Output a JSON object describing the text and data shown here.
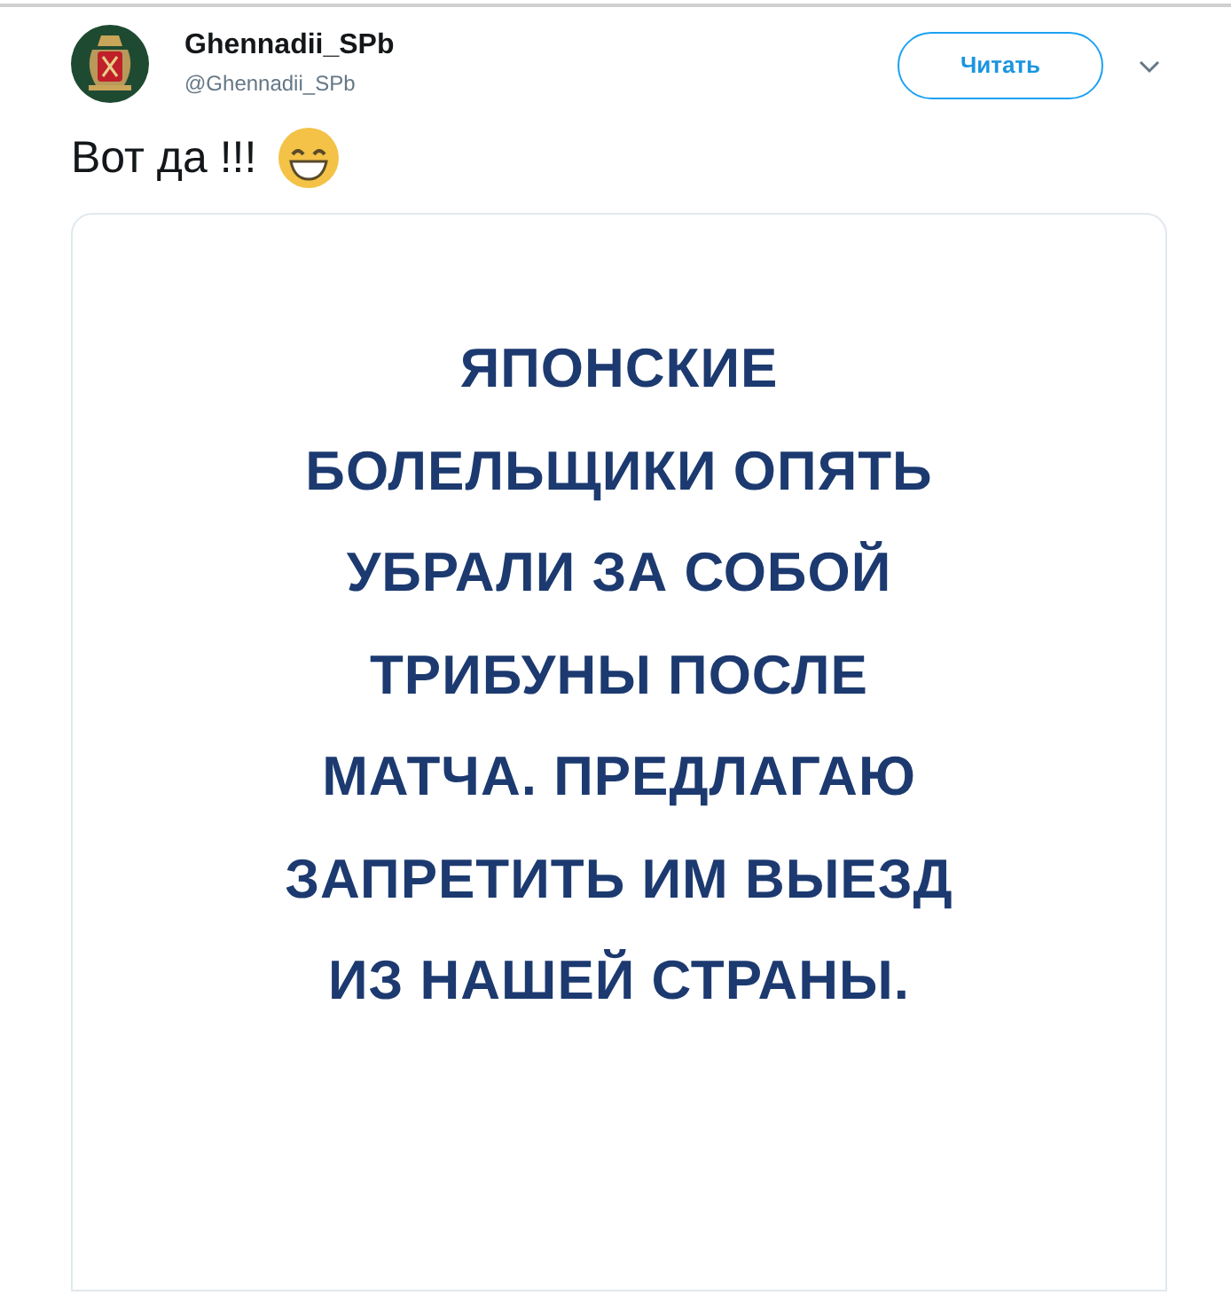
{
  "tweet": {
    "display_name": "Ghennadii_SPb",
    "handle": "@Ghennadii_SPb",
    "follow_button": "Читать",
    "text": "Вот да !!!",
    "image_text": [
      "ЯПОНСКИЕ",
      "БОЛЕЛЬЩИКИ ОПЯТЬ",
      "УБРАЛИ ЗА СОБОЙ",
      "ТРИБУНЫ ПОСЛЕ",
      "МАТЧА. ПРЕДЛАГАЮ",
      "ЗАПРЕТИТЬ ИМ ВЫЕЗД",
      "ИЗ НАШЕЙ СТРАНЫ."
    ]
  }
}
